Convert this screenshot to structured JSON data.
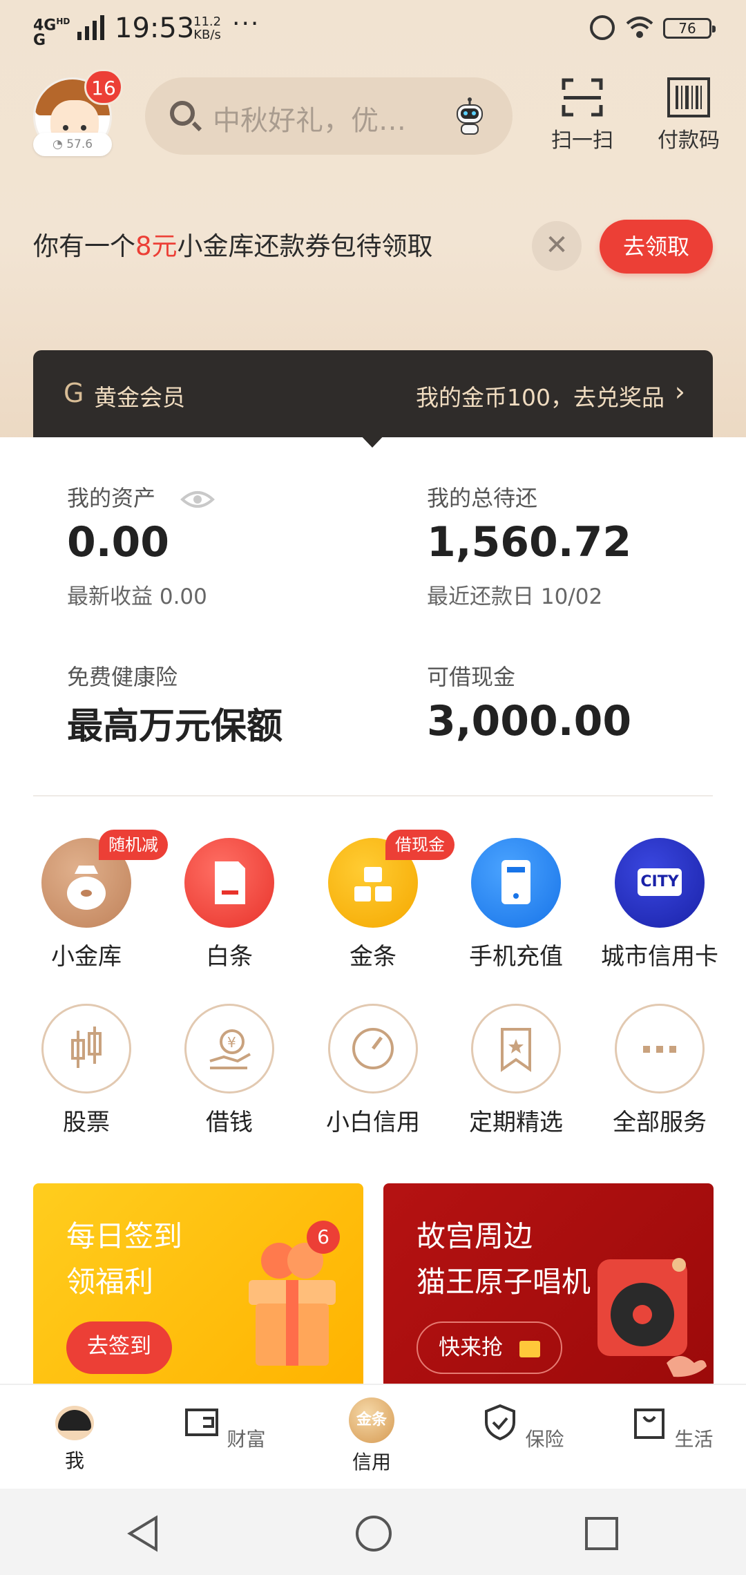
{
  "status_bar": {
    "network": "4G",
    "network_sub": "HD",
    "network2": "G",
    "time": "19:53",
    "speed_value": "11.2",
    "speed_unit": "KB/s",
    "more": "···",
    "battery": "76"
  },
  "header": {
    "avatar_badge": "16",
    "score": "57.6",
    "search_placeholder": "中秋好礼，优…",
    "scan_label": "扫一扫",
    "paycode_label": "付款码"
  },
  "coupon": {
    "text_before": "你有一个",
    "highlight": "8元",
    "text_after": "小金库还款券包待领取",
    "close_symbol": "✕",
    "claim_label": "去领取"
  },
  "member": {
    "logo": "G",
    "name": "黄金会员",
    "coins_text": "我的金币100，去兑奖品",
    "chevron": "›"
  },
  "assets": {
    "my_assets_label": "我的资产",
    "my_assets_value": "0.00",
    "latest_income": "最新收益 0.00",
    "total_due_label": "我的总待还",
    "total_due_value": "1,560.72",
    "recent_due_date": "最近还款日 10/02",
    "insurance_label": "免费健康险",
    "insurance_value": "最高万元保额",
    "cash_label": "可借现金",
    "cash_value": "3,000.00"
  },
  "services_row1": [
    {
      "label": "小金库",
      "tag": "随机减"
    },
    {
      "label": "白条",
      "tag": ""
    },
    {
      "label": "金条",
      "tag": "借现金"
    },
    {
      "label": "手机充值",
      "tag": ""
    },
    {
      "label": "城市信用卡",
      "tag": "",
      "icon_text": "CITY"
    }
  ],
  "services_row2": [
    {
      "label": "股票"
    },
    {
      "label": "借钱"
    },
    {
      "label": "小白信用"
    },
    {
      "label": "定期精选"
    },
    {
      "label": "全部服务"
    }
  ],
  "promos": {
    "left_line1": "每日签到",
    "left_line2": "领福利",
    "left_button": "去签到",
    "left_badge": "6",
    "right_line1": "故宫周边",
    "right_line2": "猫王原子唱机",
    "right_button": "快来抢"
  },
  "tabs": {
    "me": "我",
    "wealth": "财富",
    "credit": "信用",
    "credit_icon_text": "金条",
    "insurance": "保险",
    "life": "生活"
  },
  "colors": {
    "accent_red": "#ec3f36",
    "member_bar": "#2f2c2a",
    "gold": "#d8bd96"
  }
}
